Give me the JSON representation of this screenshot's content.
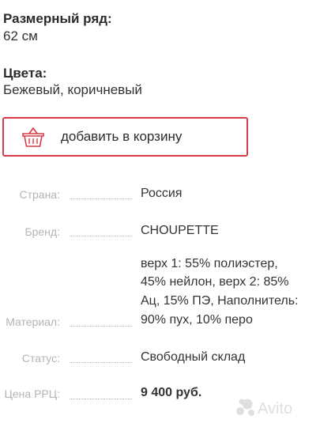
{
  "size": {
    "label": "Размерный ряд:",
    "value": "62 см"
  },
  "colors": {
    "label": "Цвета:",
    "value": "Бежевый, коричневый"
  },
  "cart_button": {
    "label": "добавить в корзину",
    "icon": "basket-icon"
  },
  "specs": {
    "country": {
      "label": "Страна:",
      "value": "Россия"
    },
    "brand": {
      "label": "Бренд:",
      "value": "CHOUPETTE"
    },
    "material": {
      "label": "Материал:",
      "lines": [
        "верх 1: 55% полиэстер,",
        "45% нейлон, верх 2: 85%",
        "Ац, 15% ПЭ, Наполнитель:",
        "90% пух, 10% перо"
      ]
    },
    "status": {
      "label": "Статус:",
      "value": "Свободный склад"
    },
    "price": {
      "label": "Цена РРЦ:",
      "value": "9 400 руб."
    }
  },
  "watermark": {
    "text": "Avito"
  },
  "accent_color": "#d63b47"
}
